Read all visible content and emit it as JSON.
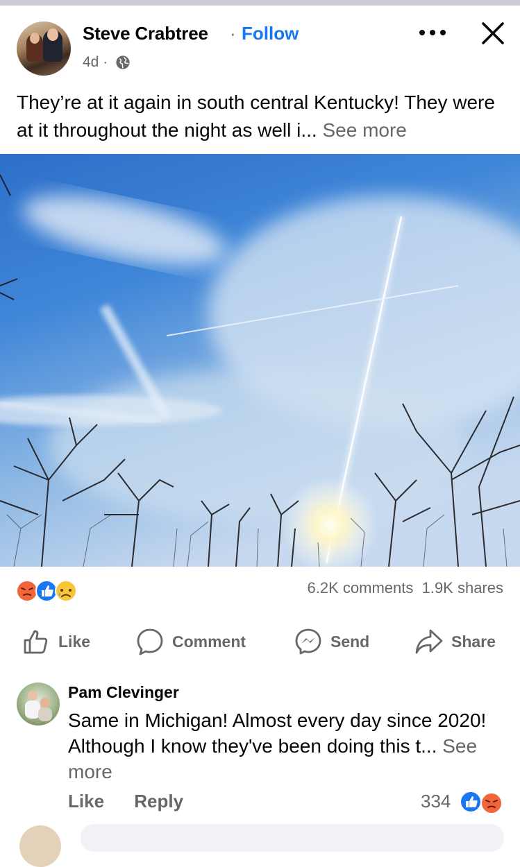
{
  "post": {
    "author": "Steve Crabtree",
    "separator": "·",
    "follow_label": "Follow",
    "time": "4d ·",
    "privacy_icon": "globe-icon",
    "text": "They’re at it again in south central Kentucky! They were at it throughout the night as well i...",
    "see_more": "See more"
  },
  "reactions": {
    "icons": [
      "angry-icon",
      "like-icon",
      "sad-icon"
    ],
    "comments": "6.2K comments",
    "shares": "1.9K shares"
  },
  "actions": [
    {
      "label": "Like",
      "icon": "thumbs-up-icon"
    },
    {
      "label": "Comment",
      "icon": "comment-bubble-icon"
    },
    {
      "label": "Send",
      "icon": "messenger-icon"
    },
    {
      "label": "Share",
      "icon": "share-arrow-icon"
    }
  ],
  "comment": {
    "author": "Pam Clevinger",
    "text": "Same in Michigan!  Almost every day since 2020!  Although I know they've been doing this t...",
    "see_more": "See more",
    "like_label": "Like",
    "reply_label": "Reply",
    "reaction_count": "334",
    "reaction_icons": [
      "like-icon",
      "angry-icon"
    ]
  },
  "colors": {
    "accent": "#1877f2",
    "secondary_text": "#65676b",
    "angry": "#f2643a",
    "sad": "#f7c736"
  }
}
